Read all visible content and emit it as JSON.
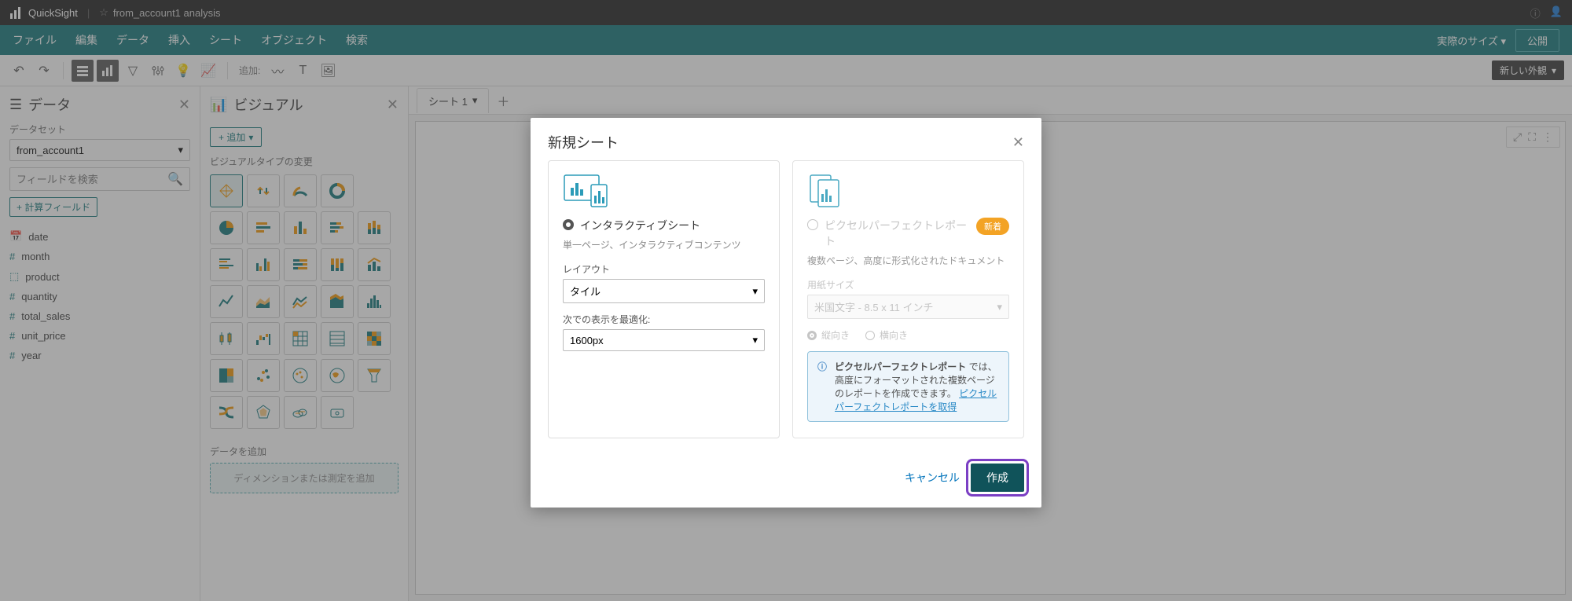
{
  "topbar": {
    "product": "QuickSight",
    "analysis_title": "from_account1 analysis"
  },
  "menubar": {
    "items": [
      "ファイル",
      "編集",
      "データ",
      "挿入",
      "シート",
      "オブジェクト",
      "検索"
    ],
    "size_label": "実際のサイズ",
    "publish": "公開"
  },
  "toolbar": {
    "add_label": "追加:",
    "appearance": "新しい外観"
  },
  "data_panel": {
    "title": "データ",
    "dataset_label": "データセット",
    "dataset_value": "from_account1",
    "search_placeholder": "フィールドを検索",
    "calc_btn": "+ 計算フィールド",
    "fields": [
      {
        "type": "date",
        "name": "date"
      },
      {
        "type": "hash",
        "name": "month"
      },
      {
        "type": "cube",
        "name": "product"
      },
      {
        "type": "hash",
        "name": "quantity"
      },
      {
        "type": "hash",
        "name": "total_sales"
      },
      {
        "type": "hash",
        "name": "unit_price"
      },
      {
        "type": "hash",
        "name": "year"
      }
    ]
  },
  "visual_panel": {
    "title": "ビジュアル",
    "add_btn": "+ 追加",
    "type_label": "ビジュアルタイプの変更",
    "add_data_label": "データを追加",
    "dropzone": "ディメンションまたは測定を追加"
  },
  "sheets": {
    "tab1": "シート 1"
  },
  "modal": {
    "title": "新規シート",
    "interactive_label": "インタラクティブシート",
    "interactive_desc": "単一ページ、インタラクティブコンテンツ",
    "layout_label": "レイアウト",
    "layout_value": "タイル",
    "optimize_label": "次での表示を最適化:",
    "optimize_value": "1600px",
    "report_label": "ピクセルパーフェクトレポート",
    "new_badge": "新着",
    "report_desc": "複数ページ、高度に形式化されたドキュメント",
    "paper_label": "用紙サイズ",
    "paper_value": "米国文字 - 8.5 x 11 インチ",
    "orient_portrait": "縦向き",
    "orient_landscape": "横向き",
    "info_text_prefix": "ピクセルパーフェクトレポート",
    "info_text_body": " では、高度にフォーマットされた複数ページのレポートを作成できます。",
    "info_link": "ピクセルパーフェクトレポートを取得",
    "cancel": "キャンセル",
    "create": "作成"
  }
}
